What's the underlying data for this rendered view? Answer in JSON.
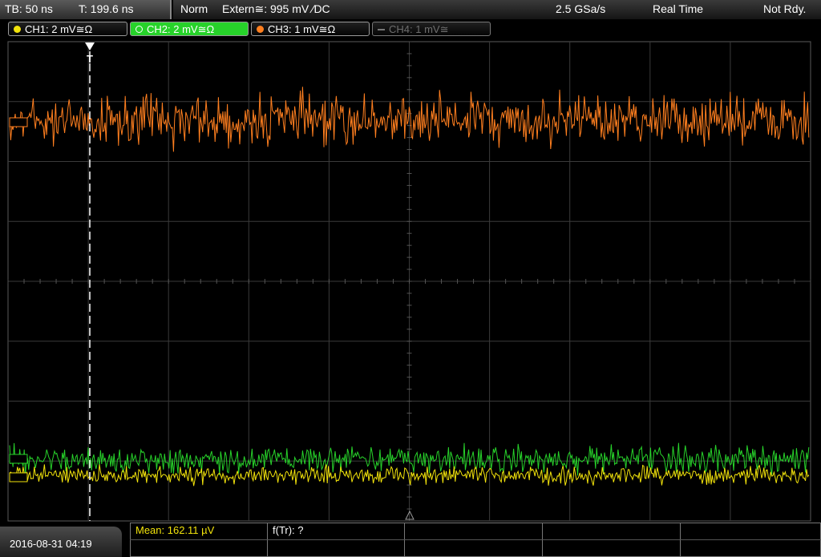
{
  "top_bar": {
    "timebase": "TB: 50 ns",
    "trigger_time": "T: 199.6 ns",
    "acq_mode": "Norm",
    "trigger_source": "Extern≅: 995 mV ∕DC",
    "sample_rate": "2.5 GSa/s",
    "run_mode": "Real Time",
    "status": "Not Rdy."
  },
  "channels": [
    {
      "label": "CH1: 2 mV≅Ω",
      "color": "#f2e30b",
      "state": "on"
    },
    {
      "label": "CH2: 2 mV≅Ω",
      "color": "#27d22a",
      "state": "selected"
    },
    {
      "label": "CH3: 1 mV≅Ω",
      "color": "#ff7f1f",
      "state": "on"
    },
    {
      "label": "CH4: 1 mV≅",
      "color": "#888888",
      "state": "off"
    }
  ],
  "trigger_marker": "T",
  "date_time": "2016-08-31 04:19",
  "measurements": {
    "mean": "Mean: 162.11 µV",
    "ftr": "f(Tr): ?"
  },
  "colors": {
    "ch1": "#f2e30b",
    "ch2": "#27d22a",
    "ch3": "#ff7f1f",
    "grid": "#3a3a3a"
  }
}
